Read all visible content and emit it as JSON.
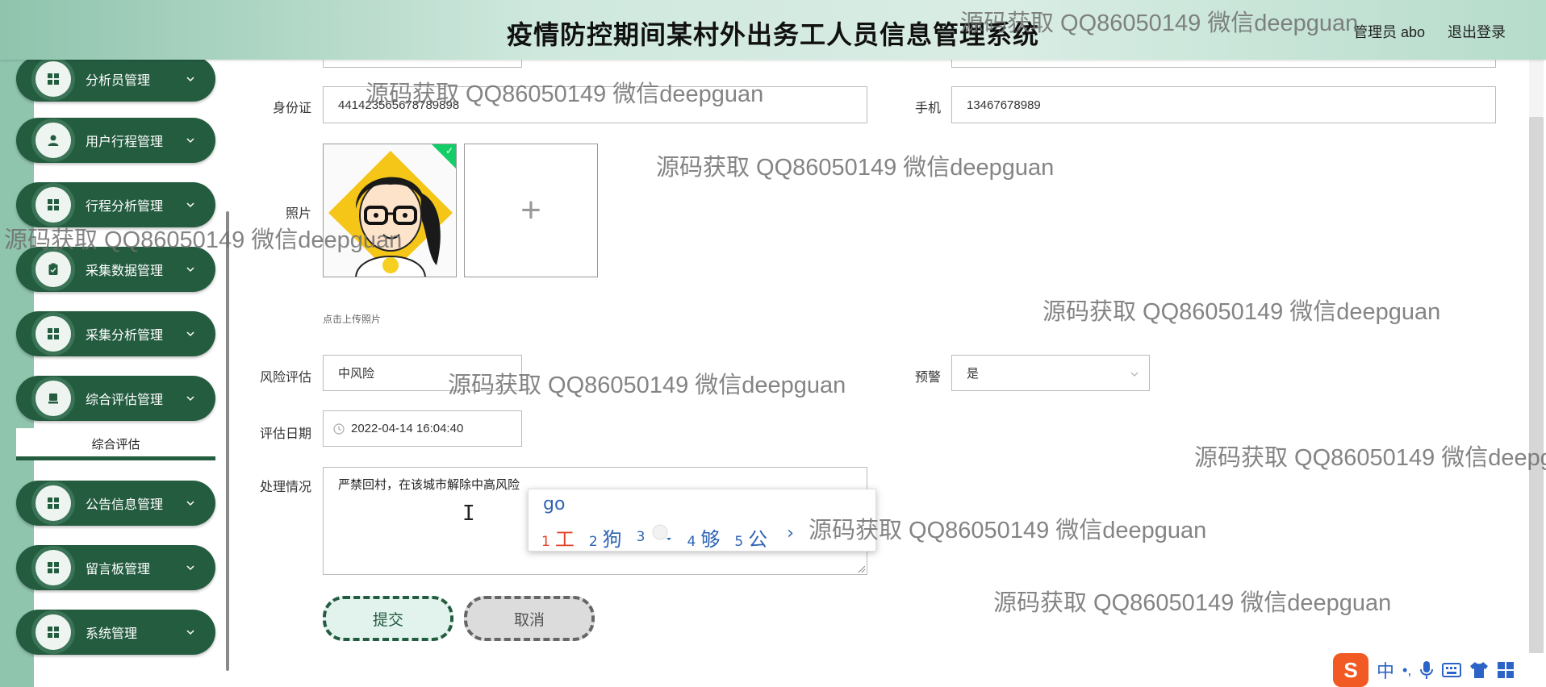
{
  "header": {
    "title": "疫情防控期间某村外出务工人员信息管理系统",
    "user_label": "管理员 abo",
    "logout_label": "退出登录"
  },
  "sidebar": {
    "items": [
      {
        "label": "分析员管理",
        "icon": "grid-icon"
      },
      {
        "label": "用户行程管理",
        "icon": "person-icon"
      },
      {
        "label": "行程分析管理",
        "icon": "grid-icon"
      },
      {
        "label": "采集数据管理",
        "icon": "clipboard-icon"
      },
      {
        "label": "采集分析管理",
        "icon": "grid-icon"
      },
      {
        "label": "综合评估管理",
        "icon": "document-icon"
      },
      {
        "label": "公告信息管理",
        "icon": "grid-icon"
      },
      {
        "label": "留言板管理",
        "icon": "grid-icon"
      },
      {
        "label": "系统管理",
        "icon": "grid-icon"
      }
    ],
    "submenu_active": "综合评估"
  },
  "form": {
    "id_card_label": "身份证",
    "id_card_value": "441423565678789898",
    "phone_label": "手机",
    "phone_value": "13467678989",
    "photo_label": "照片",
    "upload_hint": "点击上传照片",
    "upload_plus": "+",
    "risk_label": "风险评估",
    "risk_value": "中风险",
    "warning_label": "预警",
    "warning_value": "是",
    "date_label": "评估日期",
    "date_value": "2022-04-14 16:04:40",
    "handling_label": "处理情况",
    "handling_value": "严禁回村，在该城市解除中高风险",
    "submit_label": "提交",
    "cancel_label": "取消"
  },
  "ime": {
    "input": "go",
    "candidates": [
      {
        "num": "1",
        "char": "工"
      },
      {
        "num": "2",
        "char": "狗"
      },
      {
        "num": "3",
        "char": ""
      },
      {
        "num": "4",
        "char": "够"
      },
      {
        "num": "5",
        "char": "公"
      }
    ],
    "next": "›",
    "toolbar_logo": "S",
    "toolbar_lang": "中",
    "toolbar_punct": "•,"
  },
  "watermark": {
    "text": "源码获取 QQ86050149 微信deepguan"
  },
  "colors": {
    "sidebar_green": "#245c40",
    "header_gradient_start": "#8fc4ad",
    "ime_blue": "#2f64b5",
    "ime_red": "#e0432a"
  }
}
